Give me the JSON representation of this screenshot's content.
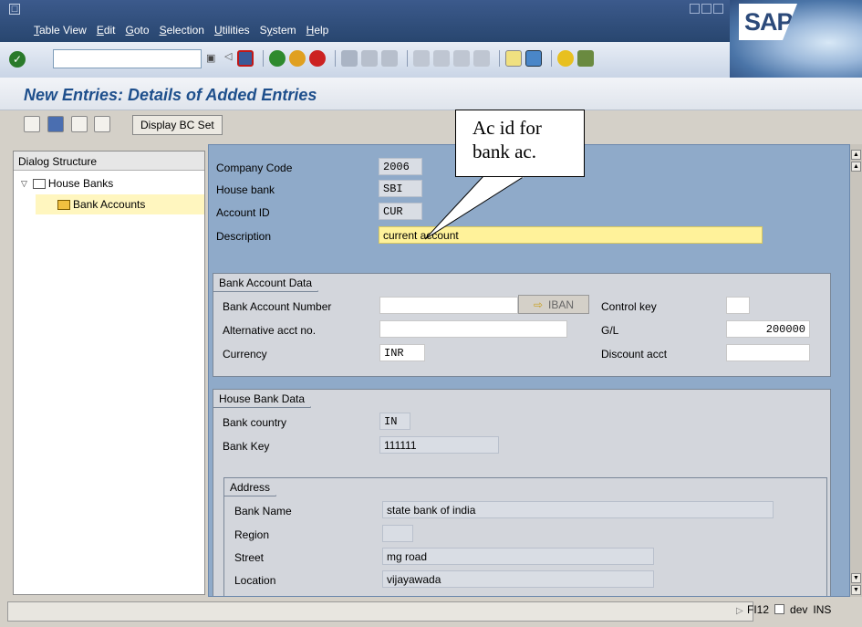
{
  "menu": [
    "Table View",
    "Edit",
    "Goto",
    "Selection",
    "Utilities",
    "System",
    "Help"
  ],
  "menu_underline": [
    "T",
    "E",
    "G",
    "S",
    "U",
    "y",
    "H"
  ],
  "logo": "SAP",
  "title": "New Entries: Details of Added Entries",
  "app_toolbar": {
    "bc_button": "Display BC Set"
  },
  "dialog": {
    "header": "Dialog Structure",
    "items": [
      "House Banks",
      "Bank Accounts"
    ]
  },
  "form": {
    "company_code_label": "Company Code",
    "company_code": "2006",
    "house_bank_label": "House bank",
    "house_bank": "SBI",
    "account_id_label": "Account ID",
    "account_id": "CUR",
    "description_label": "Description",
    "description": "current account"
  },
  "bank_account_data": {
    "title": "Bank Account Data",
    "bank_acct_no_label": "Bank Account Number",
    "bank_acct_no": "",
    "iban_label": "IBAN",
    "control_key_label": "Control key",
    "control_key": "",
    "alt_acct_label": "Alternative acct no.",
    "alt_acct": "",
    "gl_label": "G/L",
    "gl": "200000",
    "currency_label": "Currency",
    "currency": "INR",
    "discount_label": "Discount acct",
    "discount": ""
  },
  "house_bank_data": {
    "title": "House Bank Data",
    "country_label": "Bank country",
    "country": "IN",
    "key_label": "Bank Key",
    "key": "111111"
  },
  "address": {
    "title": "Address",
    "name_label": "Bank Name",
    "name": "state bank of india",
    "region_label": "Region",
    "region": "",
    "street_label": "Street",
    "street": "mg road",
    "location_label": "Location",
    "location": "vijayawada"
  },
  "callout": {
    "line1": "Ac id for",
    "line2": "bank ac."
  },
  "status": {
    "transaction": "FI12",
    "system": "dev",
    "mode": "INS"
  },
  "colors": {
    "menubar": "#2f4e7e",
    "title_text": "#1e4f8c",
    "panel_bg": "#8faac9",
    "highlight": "#fff29a"
  }
}
